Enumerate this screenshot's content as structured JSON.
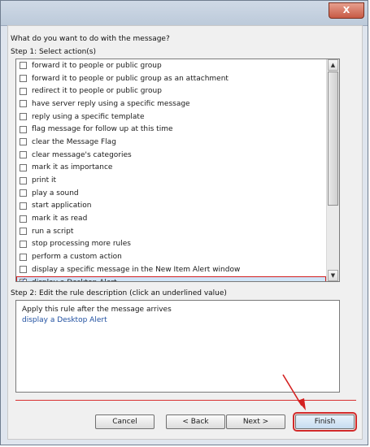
{
  "dialog": {
    "close_glyph": "X",
    "question": "What do you want to do with the message?",
    "step1_label": "Step 1: Select action(s)",
    "actions": [
      {
        "label": "forward it to people or public group",
        "checked": false
      },
      {
        "label": "forward it to people or public group as an attachment",
        "checked": false
      },
      {
        "label": "redirect it to people or public group",
        "checked": false
      },
      {
        "label": "have server reply using a specific message",
        "checked": false
      },
      {
        "label": "reply using a specific template",
        "checked": false
      },
      {
        "label": "flag message for follow up at this time",
        "checked": false
      },
      {
        "label": "clear the Message Flag",
        "checked": false
      },
      {
        "label": "clear message's categories",
        "checked": false
      },
      {
        "label": "mark it as importance",
        "checked": false
      },
      {
        "label": "print it",
        "checked": false
      },
      {
        "label": "play a sound",
        "checked": false
      },
      {
        "label": "start application",
        "checked": false
      },
      {
        "label": "mark it as read",
        "checked": false
      },
      {
        "label": "run a script",
        "checked": false
      },
      {
        "label": "stop processing more rules",
        "checked": false
      },
      {
        "label": "perform a custom action",
        "checked": false
      },
      {
        "label": "display a specific message in the New Item Alert window",
        "checked": false
      },
      {
        "label": "display a Desktop Alert",
        "checked": true,
        "selected": true
      }
    ],
    "step2_label": "Step 2: Edit the rule description (click an underlined value)",
    "description_lines": [
      "Apply this rule after the message arrives",
      "display a Desktop Alert"
    ],
    "buttons": {
      "cancel": "Cancel",
      "back": "< Back",
      "next": "Next >",
      "finish": "Finish"
    }
  }
}
